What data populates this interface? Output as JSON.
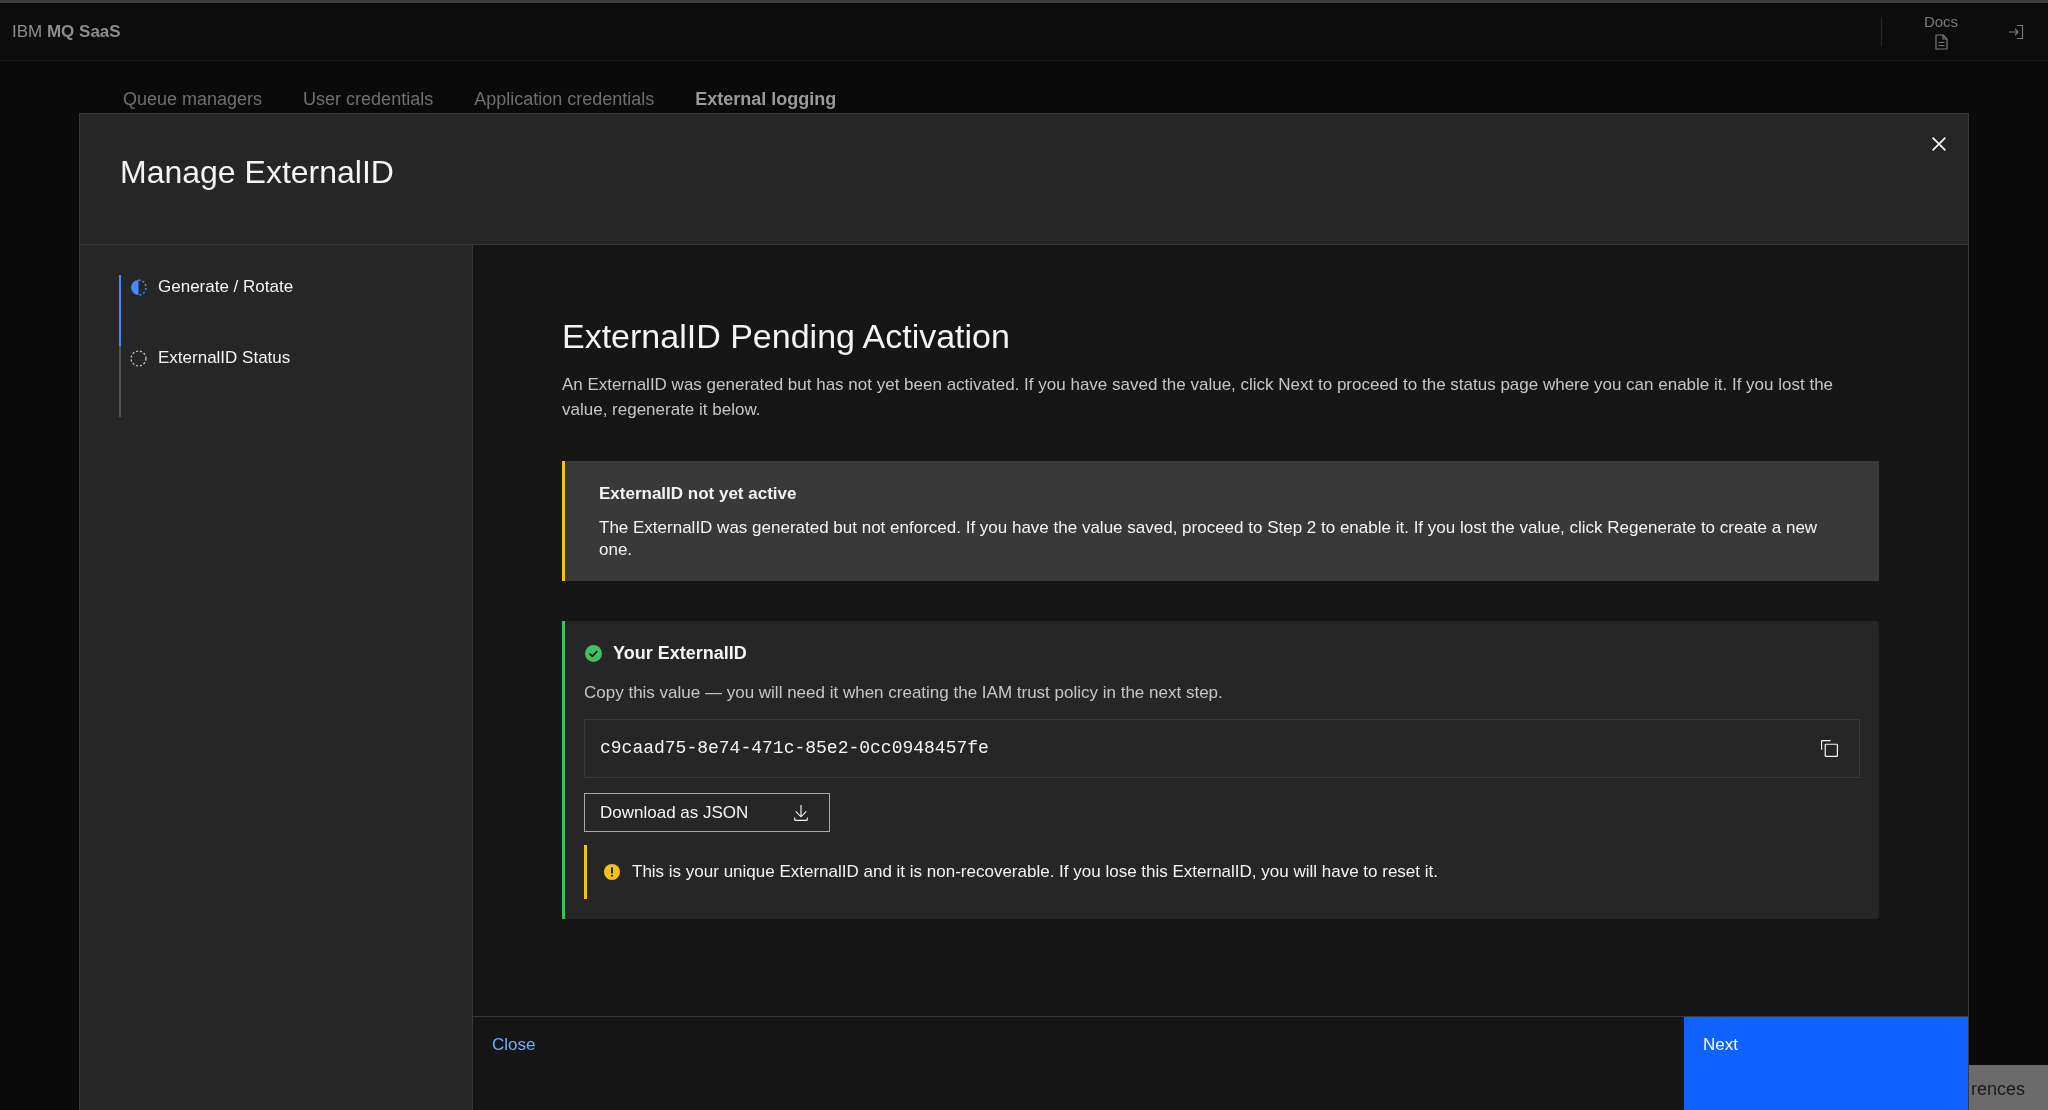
{
  "app_header": {
    "brand": "IBM **MQ SaaS**",
    "docs_label": "Docs"
  },
  "tabs": [
    {
      "label": "Queue managers",
      "selected": false
    },
    {
      "label": "User credentials",
      "selected": false
    },
    {
      "label": "Application credentials",
      "selected": false
    },
    {
      "label": "External logging",
      "selected": true
    }
  ],
  "background_button": {
    "label": "rences"
  },
  "modal": {
    "title": "Manage ExternalID",
    "steps": [
      {
        "label": "Generate / Rotate",
        "current": true
      },
      {
        "label": "ExternalID Status",
        "current": false
      }
    ],
    "heading": "ExternalID Pending Activation",
    "description": "An ExternalID was generated but has not yet been activated. If you have saved the value, click Next to proceed to the status page where you can enable it. If you lost the value, regenerate it below.",
    "notification": {
      "kind": "warning",
      "title": "ExternalID not yet active",
      "body": "The ExternalID was generated but not enforced. If you have the value saved, proceed to Step 2 to enable it. If you lost the value, click Regenerate to create a new one."
    },
    "externalid_card": {
      "kind": "success",
      "title": "Your ExternalID",
      "description": "Copy this value — you will need it when creating the IAM trust policy in the next step.",
      "value": "c9caad75-8e74-471c-85e2-0cc0948457fe",
      "download_label": "Download as JSON",
      "notice": {
        "kind": "warning",
        "text": "This is your unique ExternalID and it is non-recoverable. If you lose this ExternalID, you will have to reset it."
      }
    },
    "footer": {
      "secondary_label": "Close",
      "primary_label": "Next"
    }
  }
}
